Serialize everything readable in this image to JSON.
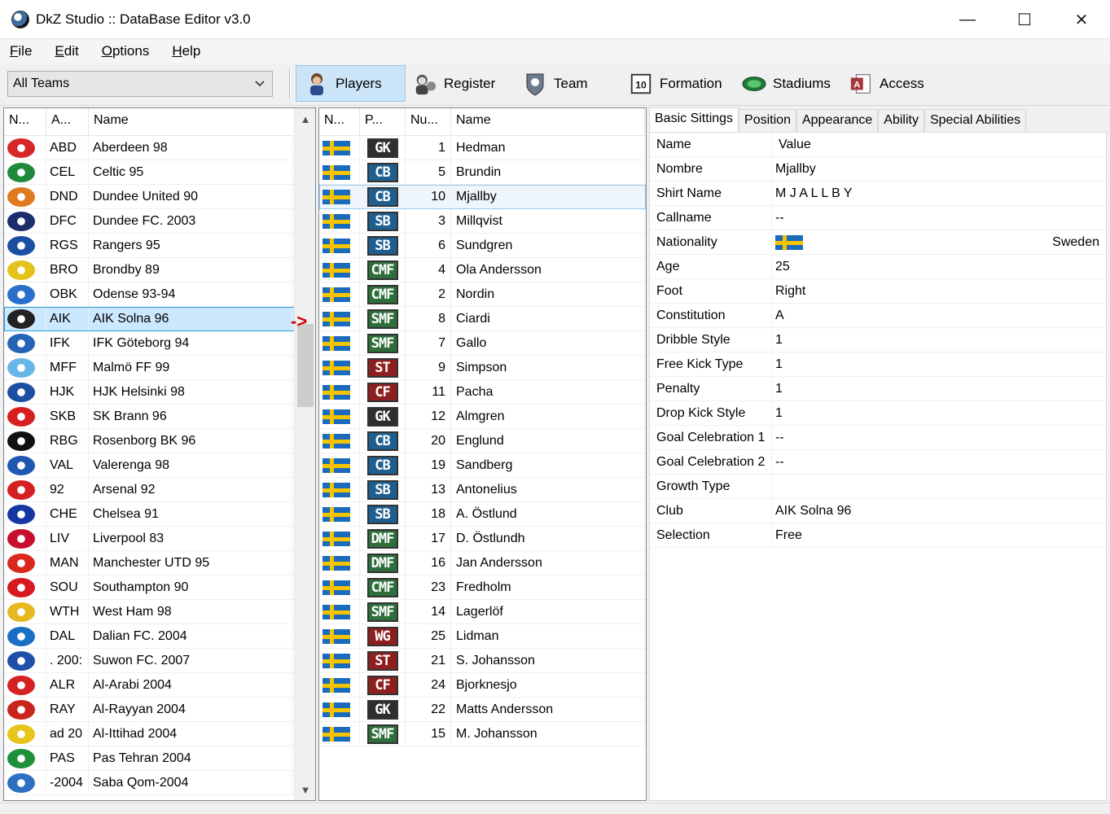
{
  "window": {
    "title": "DkZ Studio :: DataBase Editor v3.0"
  },
  "menu": [
    {
      "label": "File"
    },
    {
      "label": "Edit"
    },
    {
      "label": "Options"
    },
    {
      "label": "Help"
    }
  ],
  "toolbar": {
    "team_filter": "All Teams",
    "buttons": [
      {
        "label": "Players",
        "icon": "player-icon"
      },
      {
        "label": "Register",
        "icon": "register-icon"
      },
      {
        "label": "Team",
        "icon": "team-icon"
      },
      {
        "label": "Formation",
        "icon": "formation-icon"
      },
      {
        "label": "Stadiums",
        "icon": "stadium-icon"
      },
      {
        "label": "Access",
        "icon": "access-icon"
      }
    ]
  },
  "teams": {
    "columns": [
      "N...",
      "A...",
      "Name"
    ],
    "rows": [
      {
        "abbr": "ABD",
        "name": "Aberdeen 98",
        "color": "#d62828"
      },
      {
        "abbr": "CEL",
        "name": "Celtic 95",
        "color": "#1e8a3c"
      },
      {
        "abbr": "DND",
        "name": "Dundee United 90",
        "color": "#e07a1f"
      },
      {
        "abbr": "DFC",
        "name": "Dundee FC. 2003",
        "color": "#1b2d6b"
      },
      {
        "abbr": "RGS",
        "name": "Rangers 95",
        "color": "#1c4fa3"
      },
      {
        "abbr": "BRO",
        "name": "Brondby 89",
        "color": "#e3c21a"
      },
      {
        "abbr": "OBK",
        "name": "Odense 93-94",
        "color": "#2a6fc9"
      },
      {
        "abbr": "AIK",
        "name": "AIK Solna 96",
        "color": "#222222"
      },
      {
        "abbr": "IFK",
        "name": "IFK Göteborg 94",
        "color": "#2563b5"
      },
      {
        "abbr": "MFF",
        "name": "Malmö FF 99",
        "color": "#68b6e8"
      },
      {
        "abbr": "HJK",
        "name": "HJK Helsinki 98",
        "color": "#1d4ea1"
      },
      {
        "abbr": "SKB",
        "name": "SK Brann 96",
        "color": "#d81e1e"
      },
      {
        "abbr": "RBG",
        "name": "Rosenborg BK 96",
        "color": "#111111"
      },
      {
        "abbr": "VAL",
        "name": "Valerenga 98",
        "color": "#1f56b0"
      },
      {
        "abbr": "92",
        "name": "Arsenal 92",
        "color": "#d42020"
      },
      {
        "abbr": "CHE",
        "name": "Chelsea 91",
        "color": "#1636a3"
      },
      {
        "abbr": "LIV",
        "name": "Liverpool 83",
        "color": "#c8102e"
      },
      {
        "abbr": "MAN",
        "name": "Manchester UTD 95",
        "color": "#da291c"
      },
      {
        "abbr": "SOU",
        "name": "Southampton 90",
        "color": "#d71920"
      },
      {
        "abbr": "WTH",
        "name": "West Ham 98",
        "color": "#e8b820"
      },
      {
        "abbr": "DAL",
        "name": "Dalian FC. 2004",
        "color": "#1a6fc4"
      },
      {
        "abbr": ". 200:",
        "name": "Suwon FC. 2007",
        "color": "#1f4fa8"
      },
      {
        "abbr": "ALR",
        "name": "Al-Arabi 2004",
        "color": "#d42222"
      },
      {
        "abbr": "RAY",
        "name": "Al-Rayyan 2004",
        "color": "#c9251f"
      },
      {
        "abbr": "ad 20",
        "name": "Al-Ittihad 2004",
        "color": "#e8c41a"
      },
      {
        "abbr": "PAS",
        "name": "Pas Tehran 2004",
        "color": "#1e8f3a"
      },
      {
        "abbr": "-2004",
        "name": "Saba Qom-2004",
        "color": "#2d6fc0"
      }
    ]
  },
  "players": {
    "columns": [
      "N...",
      "P...",
      "Nu...",
      "Name"
    ],
    "rows": [
      {
        "pos": "GK",
        "num": "1",
        "name": "Hedman",
        "pos_color": "#2e2e2e"
      },
      {
        "pos": "CB",
        "num": "5",
        "name": "Brundin",
        "pos_color": "#1f5f8f"
      },
      {
        "pos": "CB",
        "num": "10",
        "name": "Mjallby",
        "pos_color": "#1f5f8f"
      },
      {
        "pos": "SB",
        "num": "3",
        "name": "Millqvist",
        "pos_color": "#1f5f8f"
      },
      {
        "pos": "SB",
        "num": "6",
        "name": "Sundgren",
        "pos_color": "#1f5f8f"
      },
      {
        "pos": "CMF",
        "num": "4",
        "name": "Ola Andersson",
        "pos_color": "#2d6e3a"
      },
      {
        "pos": "CMF",
        "num": "2",
        "name": "Nordin",
        "pos_color": "#2d6e3a"
      },
      {
        "pos": "SMF",
        "num": "8",
        "name": "Ciardi",
        "pos_color": "#2d6e3a"
      },
      {
        "pos": "SMF",
        "num": "7",
        "name": "Gallo",
        "pos_color": "#2d6e3a"
      },
      {
        "pos": "ST",
        "num": "9",
        "name": "Simpson",
        "pos_color": "#8e1f1f"
      },
      {
        "pos": "CF",
        "num": "11",
        "name": "Pacha",
        "pos_color": "#8e1f1f"
      },
      {
        "pos": "GK",
        "num": "12",
        "name": "Almgren",
        "pos_color": "#2e2e2e"
      },
      {
        "pos": "CB",
        "num": "20",
        "name": "Englund",
        "pos_color": "#1f5f8f"
      },
      {
        "pos": "CB",
        "num": "19",
        "name": "Sandberg",
        "pos_color": "#1f5f8f"
      },
      {
        "pos": "SB",
        "num": "13",
        "name": "Antonelius",
        "pos_color": "#1f5f8f"
      },
      {
        "pos": "SB",
        "num": "18",
        "name": "A. Östlund",
        "pos_color": "#1f5f8f"
      },
      {
        "pos": "DMF",
        "num": "17",
        "name": "D. Östlundh",
        "pos_color": "#2d6e3a"
      },
      {
        "pos": "DMF",
        "num": "16",
        "name": "Jan Andersson",
        "pos_color": "#2d6e3a"
      },
      {
        "pos": "CMF",
        "num": "23",
        "name": "Fredholm",
        "pos_color": "#2d6e3a"
      },
      {
        "pos": "SMF",
        "num": "14",
        "name": "Lagerlöf",
        "pos_color": "#2d6e3a"
      },
      {
        "pos": "WG",
        "num": "25",
        "name": "Lidman",
        "pos_color": "#8e1f1f"
      },
      {
        "pos": "ST",
        "num": "21",
        "name": "S. Johansson",
        "pos_color": "#8e1f1f"
      },
      {
        "pos": "CF",
        "num": "24",
        "name": "Bjorknesjo",
        "pos_color": "#8e1f1f"
      },
      {
        "pos": "GK",
        "num": "22",
        "name": "Matts Andersson",
        "pos_color": "#2e2e2e"
      },
      {
        "pos": "SMF",
        "num": "15",
        "name": "M. Johansson",
        "pos_color": "#2d6e3a"
      }
    ]
  },
  "details": {
    "tabs": [
      "Basic Sittings",
      "Position",
      "Appearance",
      "Ability",
      "Special Abilities"
    ],
    "header": {
      "key": "Name",
      "value": "Value"
    },
    "props": [
      {
        "key": "Nombre",
        "value": "Mjallby"
      },
      {
        "key": "Shirt Name",
        "value": "M J A L L B Y"
      },
      {
        "key": "Callname",
        "value": "--"
      },
      {
        "key": "Nationality",
        "value": "",
        "flag": true,
        "extra": "Sweden"
      },
      {
        "key": "Age",
        "value": "25"
      },
      {
        "key": "Foot",
        "value": "Right"
      },
      {
        "key": "Constitution",
        "value": "A"
      },
      {
        "key": "Dribble Style",
        "value": "1"
      },
      {
        "key": "Free Kick Type",
        "value": "1"
      },
      {
        "key": "Penalty",
        "value": "1"
      },
      {
        "key": "Drop Kick Style",
        "value": "1"
      },
      {
        "key": "Goal Celebration 1",
        "value": "--"
      },
      {
        "key": "Goal Celebration 2",
        "value": "--"
      },
      {
        "key": "Growth Type",
        "value": ""
      },
      {
        "key": "Club",
        "value": "AIK Solna 96"
      },
      {
        "key": "Selection",
        "value": "Free"
      }
    ]
  }
}
